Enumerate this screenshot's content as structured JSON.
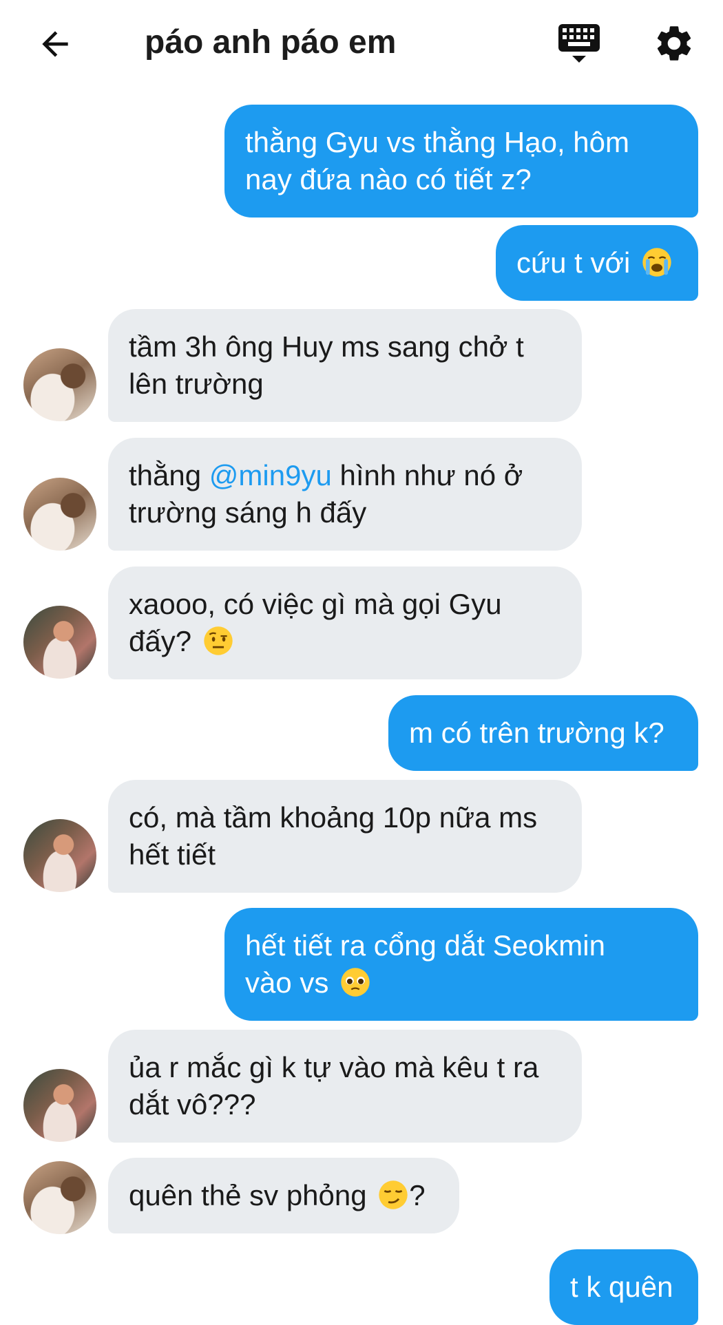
{
  "header": {
    "title": "páo anh páo em",
    "back_icon": "arrow-left-icon",
    "keyboard_icon": "keyboard-icon",
    "settings_icon": "gear-icon"
  },
  "colors": {
    "outgoing_bubble": "#1d9bf0",
    "incoming_bubble": "#e9ecef",
    "mention": "#1d9bf0"
  },
  "messages": [
    {
      "direction": "out",
      "lines": [
        "thằng Gyu vs thằng Hạo, hôm",
        "nay đứa nào có tiết z?"
      ]
    },
    {
      "direction": "out",
      "text": "cứu t với",
      "emoji": "loudly-crying-face"
    },
    {
      "direction": "in",
      "avatar": "avatar-1",
      "lines": [
        "tầm 3h ông Huy ms sang chở t",
        "lên trường"
      ]
    },
    {
      "direction": "in",
      "avatar": "avatar-1",
      "line1_before": "thằng ",
      "mention": "@min9yu",
      "line1_after": " hình như nó ở",
      "line2": "trường sáng h đấy"
    },
    {
      "direction": "in",
      "avatar": "avatar-2",
      "line1": "xaooo, có việc gì mà gọi Gyu",
      "line2": "đấy?",
      "emoji": "face-with-raised-eyebrow"
    },
    {
      "direction": "out",
      "text": "m có trên trường k?"
    },
    {
      "direction": "in",
      "avatar": "avatar-2",
      "lines": [
        "có, mà tầm khoảng 10p nữa ms",
        "hết tiết"
      ]
    },
    {
      "direction": "out",
      "line1": "hết tiết ra cổng dắt Seokmin",
      "line2": "vào vs",
      "emoji": "pleading-face"
    },
    {
      "direction": "in",
      "avatar": "avatar-2",
      "lines": [
        "ủa r mắc gì k tự vào mà kêu t ra",
        "dắt vô???"
      ]
    },
    {
      "direction": "in",
      "avatar": "avatar-1",
      "text": "quên thẻ sv phỏng",
      "emoji": "smirking-face",
      "suffix": "?"
    },
    {
      "direction": "out",
      "text": "t k quên"
    }
  ]
}
